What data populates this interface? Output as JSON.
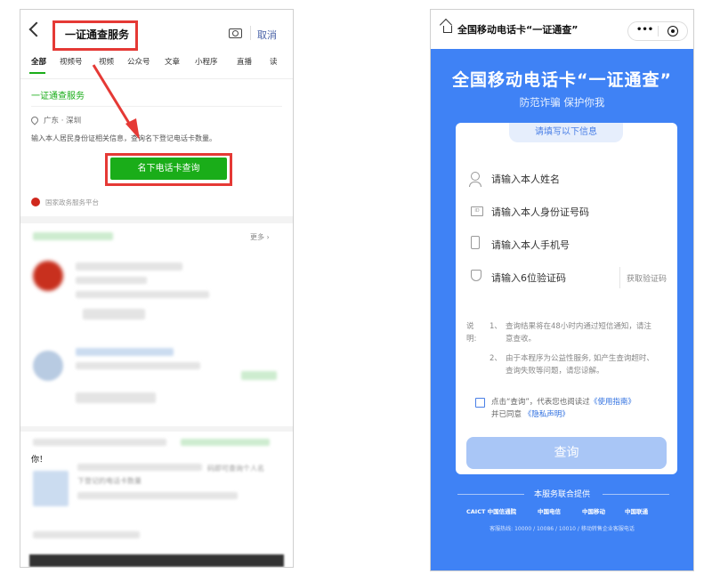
{
  "left": {
    "search_query": "一证通查服务",
    "cancel": "取消",
    "tabs": [
      "全部",
      "视频号",
      "视频",
      "公众号",
      "文章",
      "小程序",
      "直播",
      "读"
    ],
    "service_title": "一证通查服务",
    "location": "广东 · 深圳",
    "description": "输入本人居民身份证相关信息，查询名下登记电话卡数量。",
    "query_button": "名下电话卡查询",
    "provider": "国家政务服务平台",
    "more": "更多",
    "result_text_1": "你！",
    "result_text_2": "下登记的电话卡数量",
    "result_text_3": "码即可查询个人名"
  },
  "right": {
    "window_title": "全国移动电话卡“一证通查”",
    "capsule_more": "•••",
    "hero_title": "全国移动电话卡“一证通查”",
    "hero_subtitle": "防范诈骗 保护你我",
    "card_tab": "请填写以下信息",
    "fields": {
      "name": "请输入本人姓名",
      "id": "请输入本人身份证号码",
      "phone": "请输入本人手机号",
      "code": "请输入6位验证码"
    },
    "get_code": "获取验证码",
    "notes_label": "说明:",
    "notes": [
      {
        "num": "1、",
        "text": "查询结果将在48小时内通过短信通知，请注意查收。"
      },
      {
        "num": "2、",
        "text": "由于本程序为公益性服务, 如产生查询超时、查询失败等问题，请您谅解。"
      }
    ],
    "agree_prefix": "点击“查询”，代表您也阅读过",
    "agree_link1": "《使用指南》",
    "agree_mid": "并已同意",
    "agree_link2": "《隐私声明》",
    "query_button": "查询",
    "footer_title": "本服务联合提供",
    "logos": [
      "CAICT 中国信通院",
      "中国电信",
      "中国移动",
      "中国联通"
    ],
    "hotline": "客服热线: 10000 / 10086 / 10010 / 移动转售企业客服电话"
  },
  "colors": {
    "wechat_green": "#1aad19",
    "highlight_red": "#e53935",
    "brand_blue": "#3f82f5",
    "disabled_button": "#a9c6f6"
  }
}
